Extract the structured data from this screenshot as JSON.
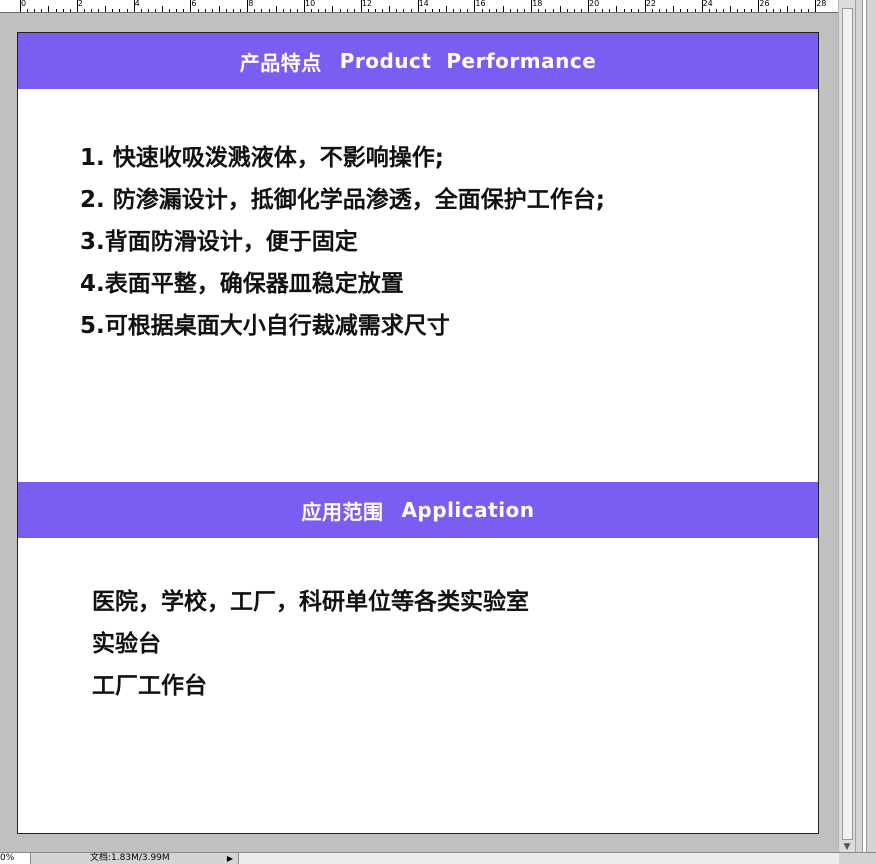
{
  "ruler": {
    "numbers": [
      "0",
      "2",
      "4",
      "6",
      "8",
      "10",
      "12",
      "14",
      "16",
      "18",
      "20",
      "22",
      "24",
      "26",
      "28"
    ]
  },
  "section1": {
    "title_cn": "产品特点",
    "title_en": "Product  Performance",
    "band_color": "#7b5df2",
    "items": [
      "1. 快速收吸泼溅液体，不影响操作;",
      "2. 防渗漏设计，抵御化学品渗透，全面保护工作台;",
      "3.背面防滑设计，便于固定",
      "4.表面平整，确保器皿稳定放置",
      "5.可根据桌面大小自行裁减需求尺寸"
    ]
  },
  "section2": {
    "title_cn": "应用范围",
    "title_en": "Application",
    "band_color": "#7b5df2",
    "items": [
      "医院，学校，工厂，科研单位等各类实验室",
      "实验台",
      "工厂工作台"
    ]
  },
  "statusbar": {
    "zoom": "0%",
    "doc_info": "文档:1.83M/3.99M"
  }
}
